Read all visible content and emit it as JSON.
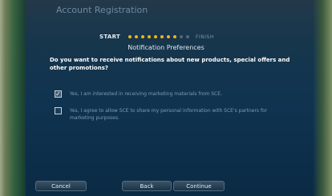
{
  "window": {
    "title": "Account Registration"
  },
  "progress": {
    "start_label": "START",
    "finish_label": "FINISH",
    "total_steps": 10,
    "completed_steps": 8,
    "active_color": "#f2b21c",
    "inactive_color": "#54677a"
  },
  "section": {
    "heading": "Notification Preferences",
    "question": "Do you want to receive notifications about new products, special offers and other promotions?"
  },
  "options": [
    {
      "label": "Yes, I am interested in receiving marketing materials from SCE.",
      "checked": true
    },
    {
      "label": "Yes, I agree to allow SCE to share my personal information with SCE's partners for marketing purposes.",
      "checked": false
    }
  ],
  "buttons": {
    "cancel": "Cancel",
    "back": "Back",
    "continue": "Continue"
  }
}
